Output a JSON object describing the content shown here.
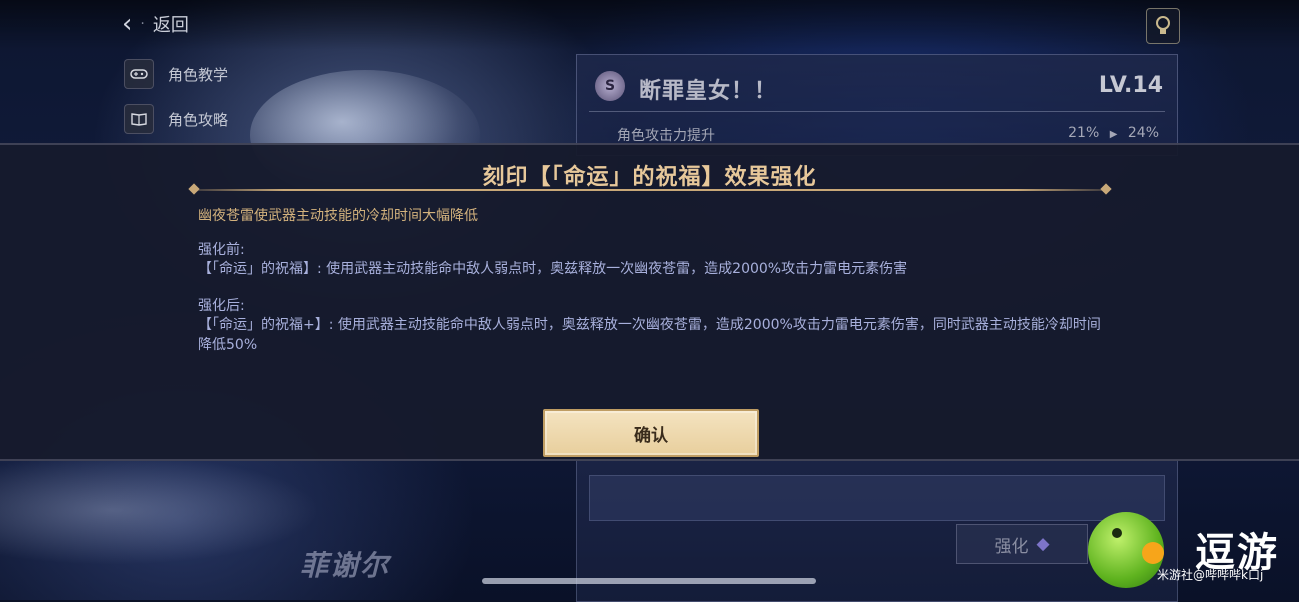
{
  "top_bar": {
    "back_label": "返回",
    "back_dots": "·"
  },
  "sidebar": {
    "items": [
      {
        "label": "角色教学",
        "icon": "gamepad-icon"
      },
      {
        "label": "角色攻略",
        "icon": "book-icon"
      }
    ]
  },
  "right_panel": {
    "title": "断罪皇女！！",
    "level": "LV.14",
    "stat_label": "角色攻击力提升",
    "stat_from": "21%",
    "stat_arrow": "▶",
    "stat_to": "24%"
  },
  "bottom_panel": {
    "enhance_label": "强化"
  },
  "character_name": "菲谢尔",
  "modal": {
    "title": "刻印【「命运」的祝福】效果强化",
    "description": "幽夜苍雷使武器主动技能的冷却时间大幅降低",
    "before_label": "强化前:",
    "before_text": "【「命运」的祝福】: 使用武器主动技能命中敌人弱点时，奥兹释放一次幽夜苍雷，造成2000%攻击力雷电元素伤害",
    "after_label": "强化后:",
    "after_text": "【「命运」的祝福+】: 使用武器主动技能命中敌人弱点时，奥兹释放一次幽夜苍雷，造成2000%攻击力雷电元素伤害，同时武器主动技能冷却时间降低50%",
    "confirm_label": "确认"
  },
  "watermark": {
    "text": "逗游",
    "sub": "米游社@哔哔哔k口j"
  },
  "colors": {
    "accent_gold": "#e7c89a",
    "desc_gold": "#d3b27d",
    "body_text": "#a8b0dc",
    "confirm_bg": "#f0dcb3"
  }
}
